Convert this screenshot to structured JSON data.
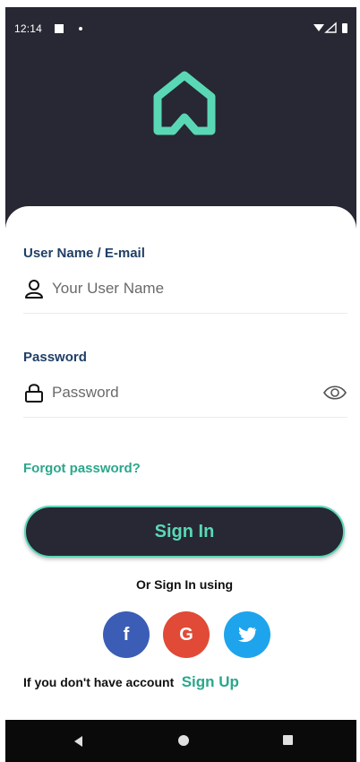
{
  "status_bar": {
    "time": "12:14"
  },
  "icons": {
    "app_logo": "home-logo-icon",
    "user": "user-icon",
    "lock": "lock-icon",
    "eye": "eye-icon",
    "facebook": "facebook-icon",
    "google": "google-icon",
    "twitter": "twitter-icon"
  },
  "form": {
    "username_label": "User Name / E-mail",
    "username_placeholder": "Your User Name",
    "password_label": "Password",
    "password_placeholder": "Password",
    "forgot_password": "Forgot password?",
    "sign_in_button": "Sign In"
  },
  "social": {
    "heading": "Or Sign In using",
    "facebook_glyph": "f",
    "google_glyph": "G"
  },
  "footer": {
    "account_text": "If you don't have account",
    "sign_up_link": "Sign Up"
  },
  "colors": {
    "header_bg": "#272833",
    "accent": "#5ad8b6",
    "label": "#1f3f66",
    "link": "#2aa78c",
    "facebook": "#3b5db5",
    "google": "#e04a36",
    "twitter": "#1ea4ec"
  }
}
